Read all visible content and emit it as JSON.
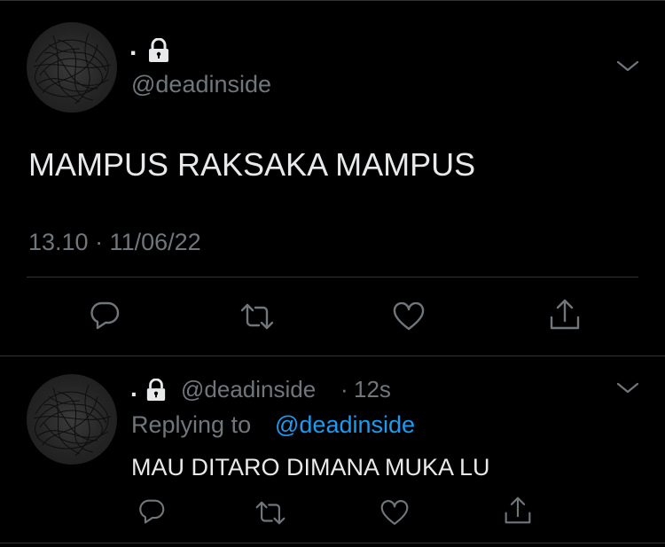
{
  "main_tweet": {
    "display_name": ".",
    "handle": "@deadinside",
    "text": "MAMPUS RAKSAKA MAMPUS",
    "timestamp": "13.10 · 11/06/22"
  },
  "reply_tweet": {
    "display_name": ".",
    "handle": "@deadinside",
    "separator": "·",
    "time_ago": "12s",
    "replying_prefix": "Replying to",
    "replying_handle": "@deadinside",
    "text": "MAU DITARO DIMANA MUKA LU"
  },
  "icons": {
    "lock": "lock-icon",
    "menu": "chevron-down-icon",
    "reply": "comment-icon",
    "retweet": "retweet-icon",
    "like": "heart-icon",
    "share": "share-icon"
  },
  "colors": {
    "background": "#000000",
    "text": "#e7e9ea",
    "muted": "#71767b",
    "link": "#1d9bf0",
    "divider": "#2f3336"
  }
}
